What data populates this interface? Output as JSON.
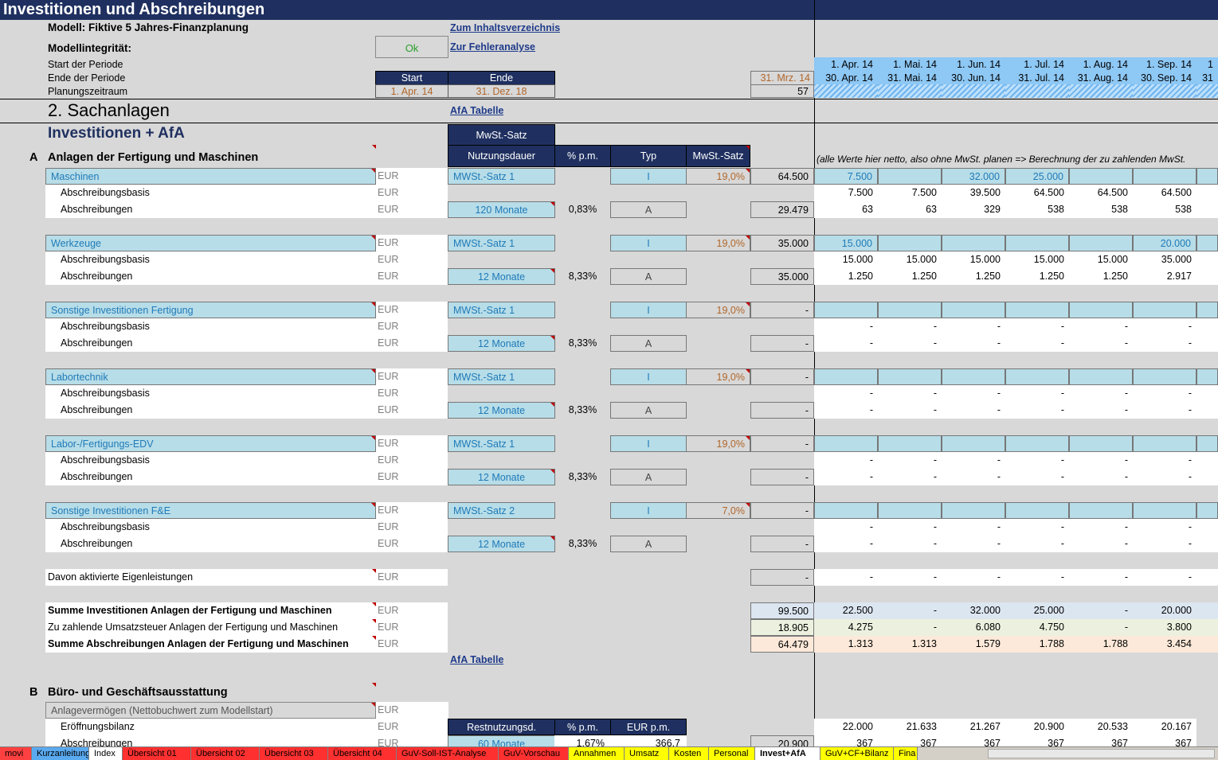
{
  "title": "Investitionen und Abschreibungen",
  "modell_label": "Modell: Fiktive 5 Jahres-Finanzplanung",
  "integritaet_label": "Modellintegrität:",
  "integritaet_value": "Ok",
  "links": {
    "inhalt": "Zum Inhaltsverzeichnis",
    "fehler": "Zur Fehleranalyse",
    "afa1": "AfA Tabelle",
    "afa2": "AfA Tabelle"
  },
  "periode": {
    "start_label": "Start der Periode",
    "ende_label": "Ende der Periode",
    "planung_label": "Planungszeitraum",
    "start_hdr": "Start",
    "ende_hdr": "Ende",
    "start_val": "1. Apr. 14",
    "ende_val": "31. Dez. 18",
    "prev_end": "31. Mrz. 14",
    "months": "57"
  },
  "months_start": [
    "1. Apr. 14",
    "1. Mai. 14",
    "1. Jun. 14",
    "1. Jul. 14",
    "1. Aug. 14",
    "1. Sep. 14",
    "1"
  ],
  "months_end": [
    "30. Apr. 14",
    "31. Mai. 14",
    "30. Jun. 14",
    "31. Jul. 14",
    "31. Aug. 14",
    "30. Sep. 14",
    "31"
  ],
  "section_title": "2. Sachanlagen",
  "subsection_title": "Investitionen + AfA",
  "table_headers": {
    "mwst_satz": "MwSt.-Satz",
    "nutzungsdauer": "Nutzungsdauer",
    "pct_pm": "% p.m.",
    "typ": "Typ",
    "mwst_satz2": "MwSt.-Satz"
  },
  "note": "(alle Werte hier netto, also ohne MwSt. planen => Berechnung der zu zahlenden MwSt.",
  "group_a": {
    "letter": "A",
    "title": "Anlagen der Fertigung und Maschinen"
  },
  "group_b": {
    "letter": "B",
    "title": "Büro- und Geschäftsausstattung"
  },
  "unit": "EUR",
  "label_basis": "Abschreibungsbasis",
  "label_abschr": "Abschreibungen",
  "typ_i": "I",
  "typ_a": "A",
  "blocks": [
    {
      "name": "Maschinen",
      "mwst": "MWSt.-Satz 1",
      "rate": "19,0%",
      "total": "64.500",
      "duration": "120 Monate",
      "pct": "0,83%",
      "abschr_total": "29.479",
      "inv": [
        "7.500",
        "",
        "32.000",
        "25.000",
        "",
        ""
      ],
      "basis": [
        "7.500",
        "7.500",
        "39.500",
        "64.500",
        "64.500",
        "64.500"
      ],
      "abschr": [
        "63",
        "63",
        "329",
        "538",
        "538",
        "538"
      ]
    },
    {
      "name": "Werkzeuge",
      "mwst": "MWSt.-Satz 1",
      "rate": "19,0%",
      "total": "35.000",
      "duration": "12 Monate",
      "pct": "8,33%",
      "abschr_total": "35.000",
      "inv": [
        "15.000",
        "",
        "",
        "",
        "",
        "20.000"
      ],
      "basis": [
        "15.000",
        "15.000",
        "15.000",
        "15.000",
        "15.000",
        "35.000"
      ],
      "abschr": [
        "1.250",
        "1.250",
        "1.250",
        "1.250",
        "1.250",
        "2.917"
      ]
    },
    {
      "name": "Sonstige Investitionen Fertigung",
      "mwst": "MWSt.-Satz 1",
      "rate": "19,0%",
      "total": "-",
      "duration": "12 Monate",
      "pct": "8,33%",
      "abschr_total": "-",
      "inv": [
        "",
        "",
        "",
        "",
        "",
        ""
      ],
      "basis": [
        "-",
        "-",
        "-",
        "-",
        "-",
        "-"
      ],
      "abschr": [
        "-",
        "-",
        "-",
        "-",
        "-",
        "-"
      ]
    },
    {
      "name": "Labortechnik",
      "mwst": "MWSt.-Satz 1",
      "rate": "19,0%",
      "total": "-",
      "duration": "12 Monate",
      "pct": "8,33%",
      "abschr_total": "-",
      "inv": [
        "",
        "",
        "",
        "",
        "",
        ""
      ],
      "basis": [
        "-",
        "-",
        "-",
        "-",
        "-",
        "-"
      ],
      "abschr": [
        "-",
        "-",
        "-",
        "-",
        "-",
        "-"
      ]
    },
    {
      "name": "Labor-/Fertigungs-EDV",
      "mwst": "MWSt.-Satz 1",
      "rate": "19,0%",
      "total": "-",
      "duration": "12 Monate",
      "pct": "8,33%",
      "abschr_total": "-",
      "inv": [
        "",
        "",
        "",
        "",
        "",
        ""
      ],
      "basis": [
        "-",
        "-",
        "-",
        "-",
        "-",
        "-"
      ],
      "abschr": [
        "-",
        "-",
        "-",
        "-",
        "-",
        "-"
      ]
    },
    {
      "name": "Sonstige Investitionen F&E",
      "mwst": "MWSt.-Satz 2",
      "rate": "7,0%",
      "total": "-",
      "duration": "12 Monate",
      "pct": "8,33%",
      "abschr_total": "-",
      "inv": [
        "",
        "",
        "",
        "",
        "",
        ""
      ],
      "basis": [
        "-",
        "-",
        "-",
        "-",
        "-",
        "-"
      ],
      "abschr": [
        "-",
        "-",
        "-",
        "-",
        "-",
        "-"
      ]
    }
  ],
  "eigenleistungen": {
    "label": "Davon aktivierte Eigenleistungen",
    "total": "-",
    "values": [
      "-",
      "-",
      "-",
      "-",
      "-",
      "-"
    ]
  },
  "summen": [
    {
      "label": "Summe Investitionen Anlagen der Fertigung und Maschinen",
      "bold": true,
      "total": "99.500",
      "values": [
        "22.500",
        "-",
        "32.000",
        "25.000",
        "-",
        "20.000"
      ],
      "color": "#dce6f1"
    },
    {
      "label": "Zu zahlende Umsatzsteuer Anlagen der Fertigung und Maschinen",
      "bold": false,
      "total": "18.905",
      "values": [
        "4.275",
        "-",
        "6.080",
        "4.750",
        "-",
        "3.800"
      ],
      "color": "#ebf1de"
    },
    {
      "label": "Summe Abschreibungen Anlagen der Fertigung und Maschinen",
      "bold": true,
      "total": "64.479",
      "values": [
        "1.313",
        "1.313",
        "1.579",
        "1.788",
        "1.788",
        "3.454"
      ],
      "color": "#fde9d9"
    }
  ],
  "group_b_rows": {
    "anlage_label": "Anlagevermögen (Nettobuchwert zum Modellstart)",
    "eroeffnung_label": "Eröffnungsbilanz",
    "abschr_label": "Abschreibungen",
    "hdr_rest": "Restnutzungsd.",
    "hdr_pct": "% p.m.",
    "hdr_eur": "EUR p.m.",
    "eroeffnung_values": [
      "22.000",
      "21.633",
      "21.267",
      "20.900",
      "20.533",
      "20.167"
    ],
    "abschr_duration": "60 Monate",
    "abschr_pct": "1,67%",
    "abschr_eur": "366,7",
    "abschr_total": "20.900",
    "abschr_values": [
      "367",
      "367",
      "367",
      "367",
      "367",
      "367"
    ]
  },
  "sheet_tabs": [
    {
      "label": "movi",
      "color": "#ff4040"
    },
    {
      "label": "Kurzanleitung",
      "color": "#5aaaf0"
    },
    {
      "label": "Index",
      "color": "#ffffff"
    },
    {
      "label": "Übersicht 01",
      "color": "#ff3030"
    },
    {
      "label": "Übersicht 02",
      "color": "#ff3030"
    },
    {
      "label": "Übersicht 03",
      "color": "#ff3030"
    },
    {
      "label": "Übersicht 04",
      "color": "#ff3030"
    },
    {
      "label": "GuV-Soll-IST-Analyse",
      "color": "#ff3030"
    },
    {
      "label": "GuV-Vorschau",
      "color": "#ff3030"
    },
    {
      "label": "Annahmen",
      "color": "#ffff00"
    },
    {
      "label": "Umsatz",
      "color": "#ffff00"
    },
    {
      "label": "Kosten",
      "color": "#ffff00"
    },
    {
      "label": "Personal",
      "color": "#ffff00"
    },
    {
      "label": "Invest+AfA",
      "color": "#ffffff"
    },
    {
      "label": "GuV+CF+Bilanz",
      "color": "#ffff00"
    },
    {
      "label": "Fina",
      "color": "#ffff00"
    }
  ]
}
